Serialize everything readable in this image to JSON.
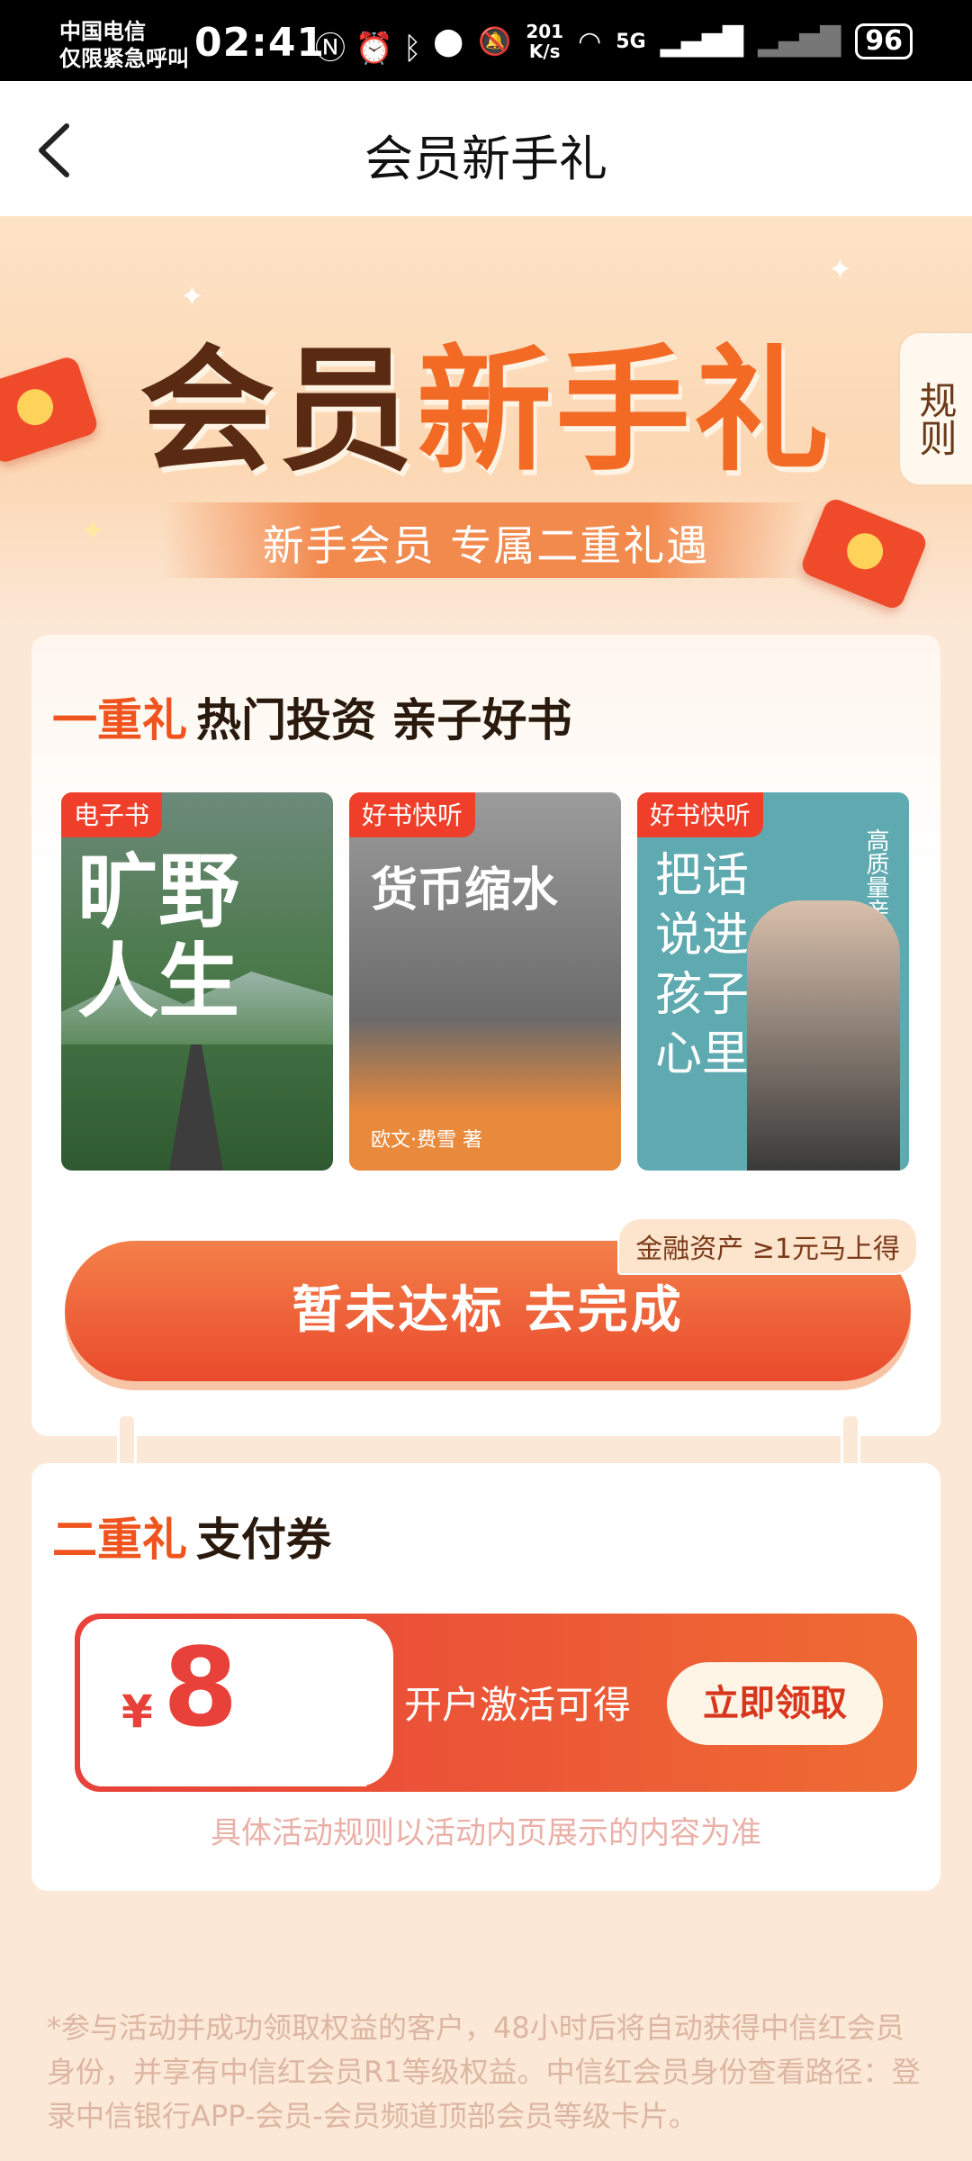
{
  "status_bar": {
    "carrier_line1": "中国电信",
    "carrier_line2": "仅限紧急呼叫",
    "time": "02:41",
    "speed_value": "201",
    "speed_unit": "K/s",
    "network": "5G",
    "battery": "96"
  },
  "nav": {
    "title": "会员新手礼"
  },
  "hero": {
    "title_part1": "会员",
    "title_part2": "新手礼",
    "subtitle": "新手会员 专属二重礼遇",
    "rules_tab": "规则"
  },
  "section1": {
    "tag": "一重礼",
    "title": "热门投资 亲子好书",
    "books": [
      {
        "badge": "电子书",
        "title": "旷野人生"
      },
      {
        "badge": "好书快听",
        "title": "货币缩水",
        "author": "欧文·费雪 著"
      },
      {
        "badge": "好书快听",
        "title": "把话说进孩子心里",
        "side": "高质量亲子沟通"
      }
    ],
    "bubble": "金融资产 ≥1元马上得",
    "button": "暂未达标 去完成"
  },
  "section2": {
    "tag": "二重礼",
    "title": "支付券",
    "coupon": {
      "currency": "¥",
      "amount": "8",
      "condition": "开户激活可得",
      "button": "立即领取"
    },
    "note": "具体活动规则以活动内页展示的内容为准"
  },
  "footer": "*参与活动并成功领取权益的客户，48小时后将自动获得中信红会员身份，并享有中信红会员R1等级权益。中信红会员身份查看路径：登录中信银行APP-会员-会员频道顶部会员等级卡片。"
}
